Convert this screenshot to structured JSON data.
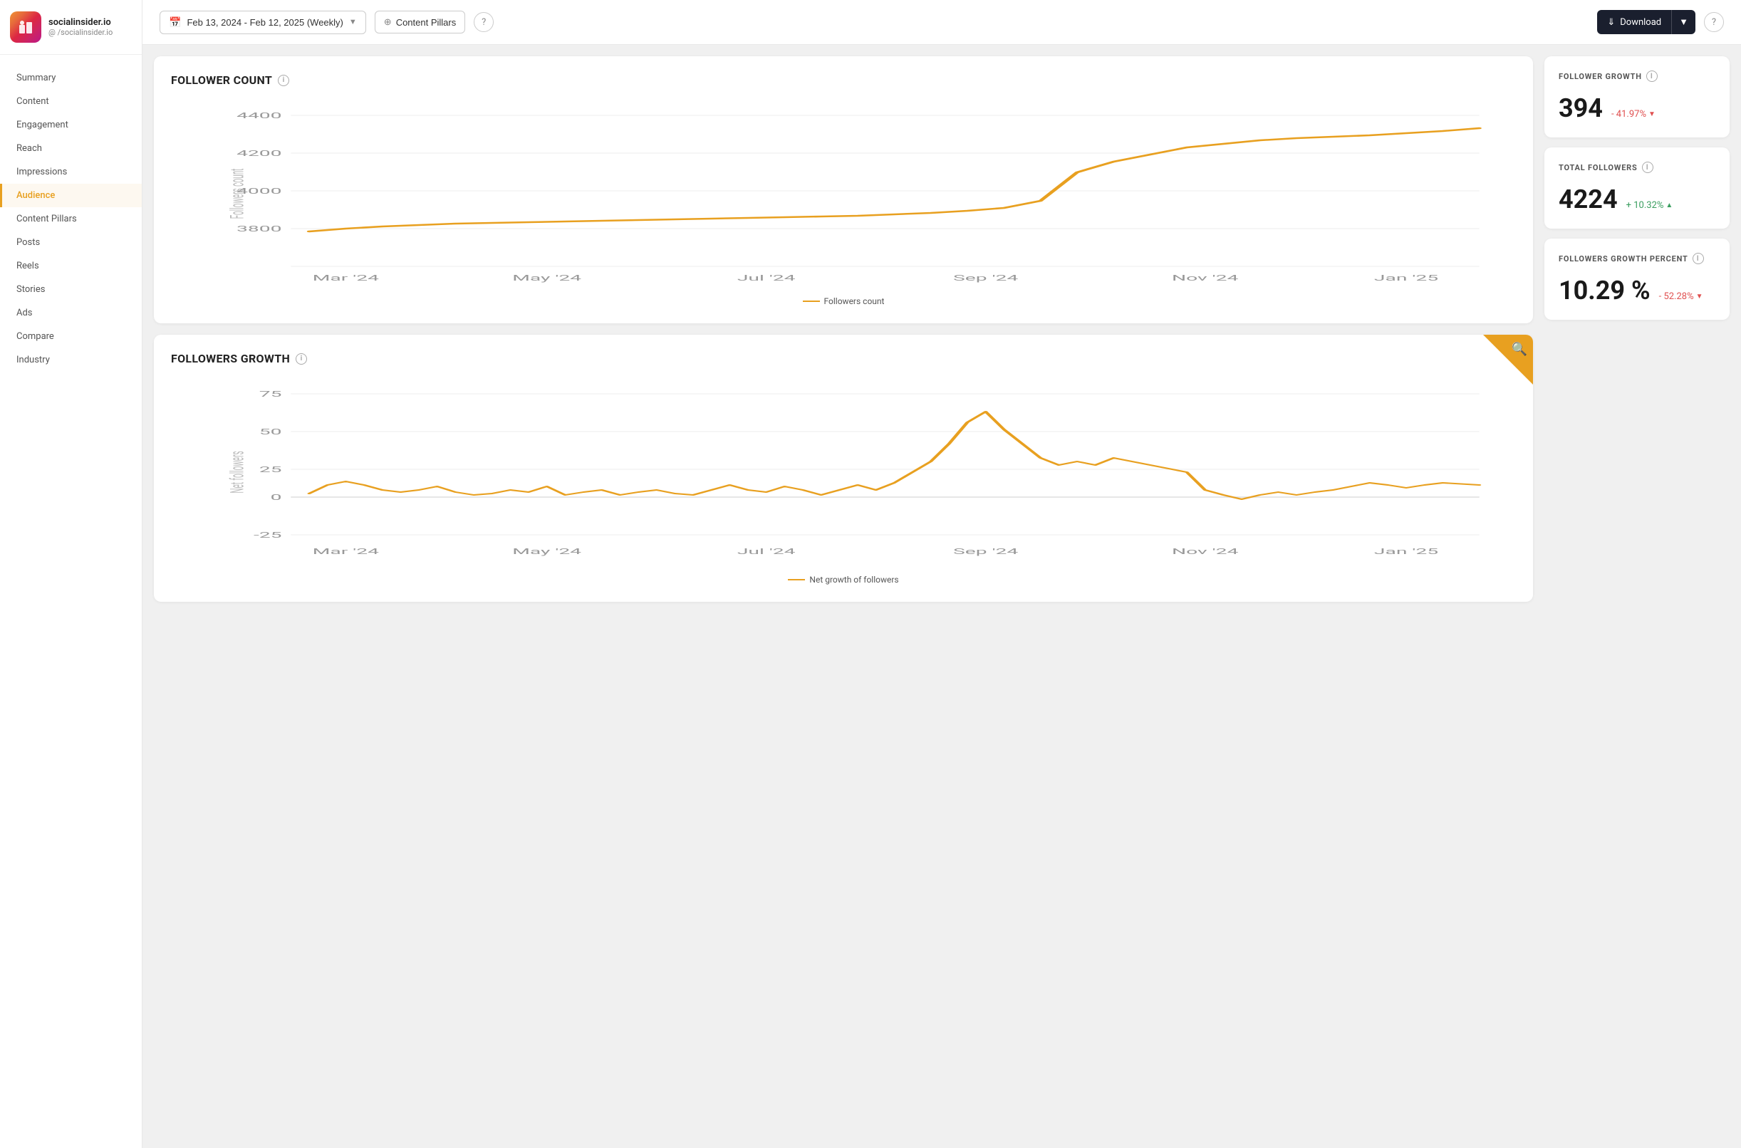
{
  "sidebar": {
    "brand": {
      "name": "socialinsider.io",
      "handle": "@ /socialinsider.io"
    },
    "items": [
      {
        "label": "Summary",
        "active": false
      },
      {
        "label": "Content",
        "active": false
      },
      {
        "label": "Engagement",
        "active": false
      },
      {
        "label": "Reach",
        "active": false
      },
      {
        "label": "Impressions",
        "active": false
      },
      {
        "label": "Audience",
        "active": true
      },
      {
        "label": "Content Pillars",
        "active": false
      },
      {
        "label": "Posts",
        "active": false
      },
      {
        "label": "Reels",
        "active": false
      },
      {
        "label": "Stories",
        "active": false
      },
      {
        "label": "Ads",
        "active": false
      },
      {
        "label": "Compare",
        "active": false
      },
      {
        "label": "Industry",
        "active": false
      }
    ]
  },
  "topbar": {
    "date_range": "Feb 13, 2024 - Feb 12, 2025 (Weekly)",
    "content_pillars": "Content Pillars",
    "download": "Download",
    "help_tooltip": "Help"
  },
  "follower_count": {
    "title": "FOLLOWER COUNT",
    "y_label": "Followers count",
    "y_values": [
      "4400",
      "4200",
      "4000",
      "3800"
    ],
    "x_values": [
      "Mar '24",
      "May '24",
      "Jul '24",
      "Sep '24",
      "Nov '24",
      "Jan '25"
    ],
    "legend": "Followers count"
  },
  "follower_growth": {
    "title": "FOLLOWERS GROWTH",
    "y_label": "Net followers",
    "y_values": [
      "75",
      "50",
      "25",
      "0",
      "-25"
    ],
    "x_values": [
      "Mar '24",
      "May '24",
      "Jul '24",
      "Sep '24",
      "Nov '24",
      "Jan '25"
    ],
    "legend": "Net growth of followers"
  },
  "stats": {
    "follower_growth_card": {
      "title": "FOLLOWER GROWTH",
      "value": "394",
      "change": "- 41.97%",
      "change_type": "negative"
    },
    "total_followers_card": {
      "title": "TOTAL FOLLOWERS",
      "value": "4224",
      "change": "+ 10.32%",
      "change_type": "positive"
    },
    "followers_growth_percent_card": {
      "title": "FOLLOWERS GROWTH PERCENT",
      "value": "10.29 %",
      "change": "- 52.28%",
      "change_type": "negative"
    }
  }
}
